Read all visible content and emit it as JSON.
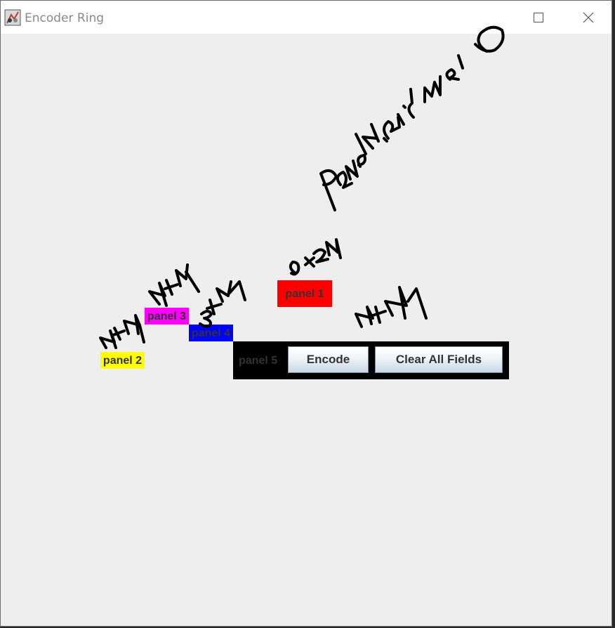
{
  "window": {
    "title": "Encoder Ring",
    "icons": [
      "java-app-icon",
      "maximize-icon",
      "close-icon"
    ]
  },
  "panels": {
    "panel1": "panel 1",
    "panel2": "panel 2",
    "panel3": "panel 3",
    "panel4": "panel 4",
    "panel5": "panel 5"
  },
  "buttons": {
    "encode": "Encode",
    "clear": "Clear All Fields"
  },
  "colors": {
    "panel1": "#ff0000",
    "panel2": "#ffff00",
    "panel3": "#ff00ff",
    "panel4": "#0000ff",
    "panel5": "#000000",
    "background": "#eeeeee"
  },
  "handwriting": {
    "top_rotated": "Panel4 GridW210",
    "above_panel1": "0x24",
    "right_of_panel1": "4t4",
    "above_panel2": "4t4",
    "above_panel3": "4t7",
    "above_panel4": "3t7"
  }
}
